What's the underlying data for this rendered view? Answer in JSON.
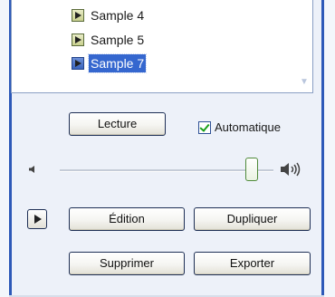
{
  "list": {
    "items": [
      {
        "label": "Sample 4",
        "selected": false
      },
      {
        "label": "Sample 5",
        "selected": false
      },
      {
        "label": "Sample 7",
        "selected": true
      }
    ]
  },
  "controls": {
    "play_button": "Lecture",
    "autoplay_label": "Automatique",
    "autoplay_checked": true
  },
  "volume": {
    "level": 0.9,
    "low_icon": "speaker-low-icon",
    "high_icon": "speaker-high-icon"
  },
  "actions": {
    "edit": "Édition",
    "duplicate": "Dupliquer",
    "delete": "Supprimer",
    "export": "Exporter"
  },
  "colors": {
    "accent": "#2d59b8",
    "selection": "#3567cf"
  }
}
